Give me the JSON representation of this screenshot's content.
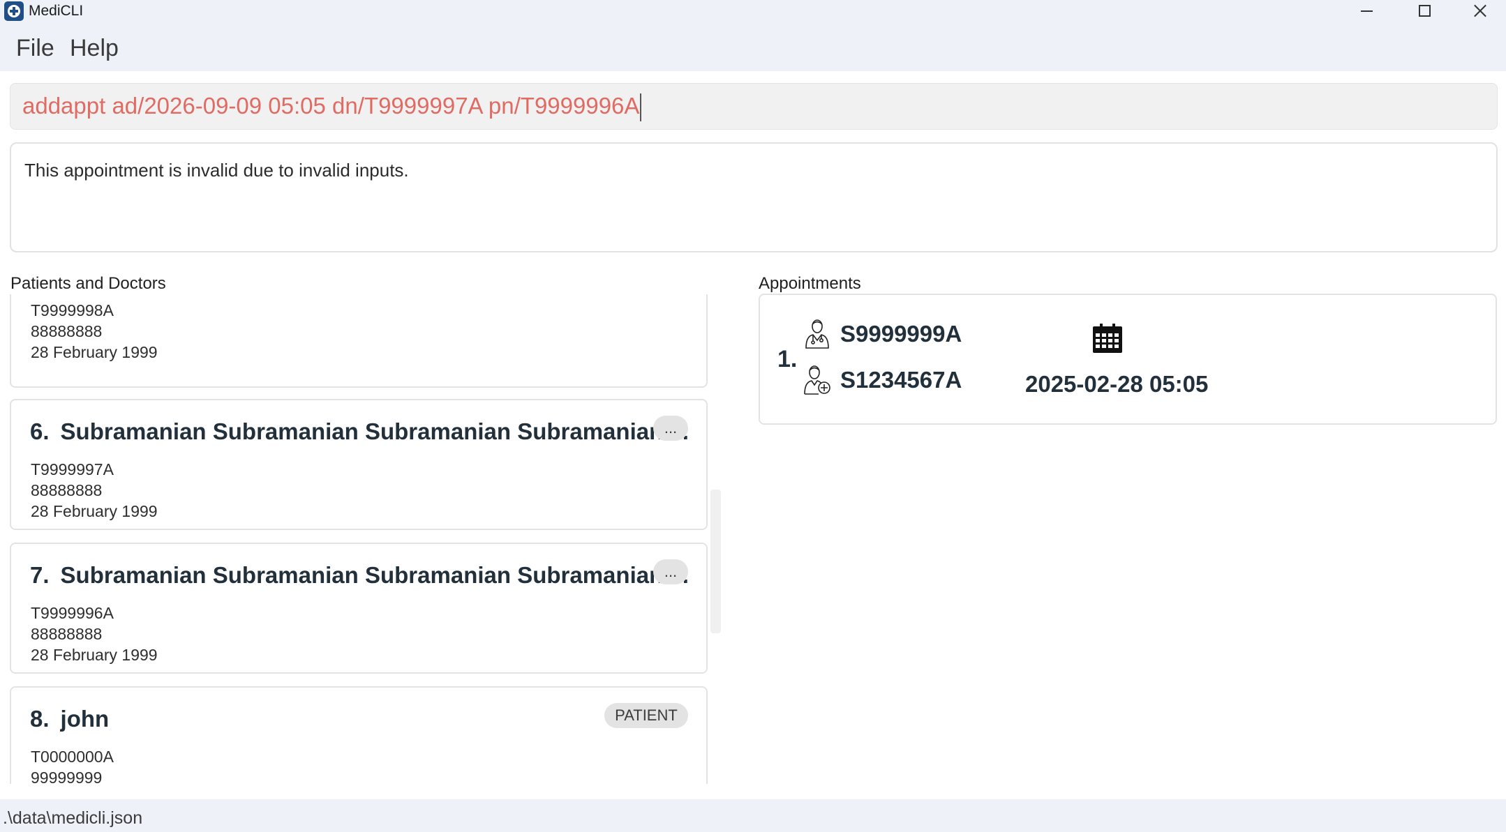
{
  "window": {
    "title": "MediCLI",
    "icon": "medicli-cross-icon"
  },
  "menu": {
    "file": "File",
    "help": "Help"
  },
  "command": {
    "value": "addappt ad/2026-09-09 05:05 dn/T9999997A pn/T9999996A"
  },
  "result": {
    "message": "This appointment is invalid due to invalid inputs."
  },
  "persons_panel": {
    "label": "Patients and Doctors",
    "partial_card": {
      "nric": "T9999998A",
      "phone": "88888888",
      "dob": "28 February 1999"
    },
    "cards": [
      {
        "index": "6.",
        "name": "Subramanian Subramanian Subramanian Subramanian ...",
        "badge": "...",
        "nric": "T9999997A",
        "phone": "88888888",
        "dob": "28 February 1999"
      },
      {
        "index": "7.",
        "name": "Subramanian Subramanian Subramanian Subramanian ...",
        "badge": "...",
        "nric": "T9999996A",
        "phone": "88888888",
        "dob": "28 February 1999"
      },
      {
        "index": "8.",
        "name": "john",
        "badge": "PATIENT",
        "nric": "T0000000A",
        "phone": "99999999"
      }
    ]
  },
  "appointments_panel": {
    "label": "Appointments",
    "items": [
      {
        "index": "1.",
        "doctor_nric": "S9999999A",
        "patient_nric": "S1234567A",
        "datetime": "2025-02-28 05:05",
        "icons": [
          "doctor-icon",
          "patient-icon",
          "calendar-icon"
        ]
      }
    ]
  },
  "status": {
    "file_path": ".\\data\\medicli.json"
  }
}
